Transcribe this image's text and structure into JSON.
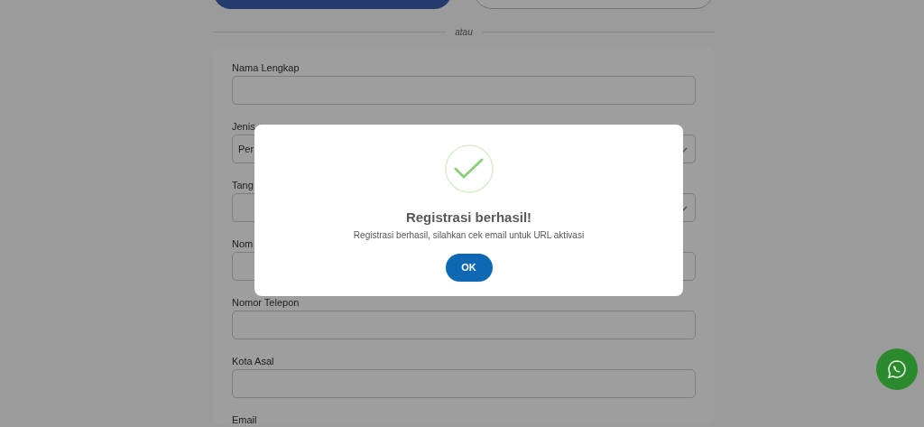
{
  "divider_text": "atau",
  "form": {
    "fields": [
      {
        "label": "Nama Lengkap",
        "kind": "text"
      },
      {
        "label": "Jenis",
        "kind": "select",
        "value": "Per"
      },
      {
        "label": "Tang",
        "kind": "select"
      },
      {
        "label": "Nom",
        "kind": "text"
      },
      {
        "label": "Nomor Telepon",
        "kind": "text"
      },
      {
        "label": "Kota Asal",
        "kind": "text"
      },
      {
        "label": "Email",
        "kind": "label"
      }
    ]
  },
  "dialog": {
    "title": "Registrasi berhasil!",
    "message": "Registrasi berhasil, silahkan cek email untuk URL aktivasi",
    "button": "OK"
  }
}
